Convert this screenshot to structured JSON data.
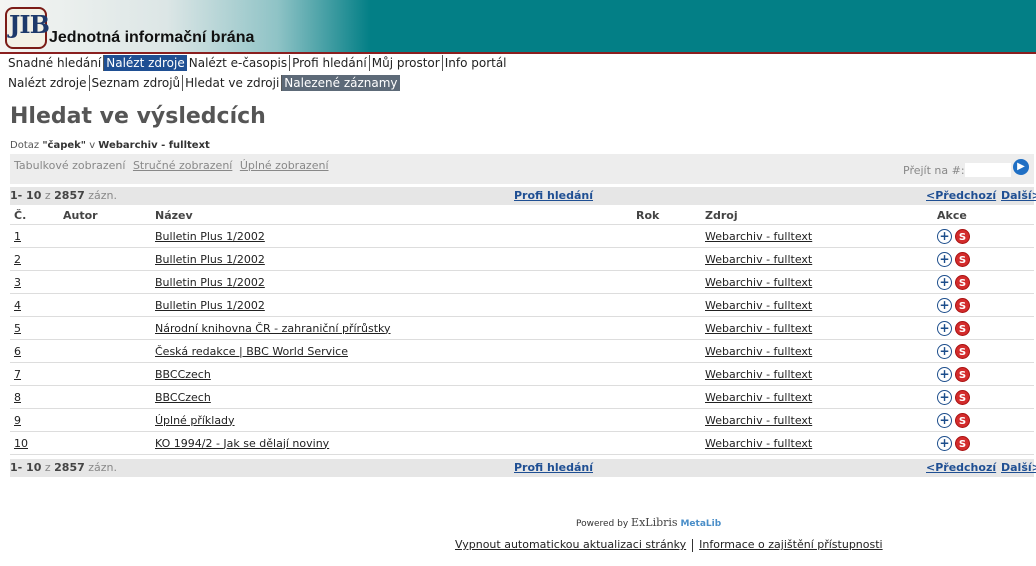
{
  "banner": {
    "logo": "JIB",
    "brand": "Jednotná informační brána"
  },
  "nav1": [
    "Snadné hledání",
    "Nalézt zdroje",
    "Nalézt e-časopis",
    "Profi hledání",
    "Můj prostor",
    "Info portál"
  ],
  "nav2": [
    "Nalézt zdroje",
    "Seznam zdrojů",
    "Hledat ve zdroji",
    "Nalezené záznamy"
  ],
  "page_title": "Hledat ve výsledcích",
  "query": {
    "prefix": "Dotaz",
    "term": "\"čapek\"",
    "mid": "v",
    "source": "Webarchiv - fulltext"
  },
  "views": {
    "table": "Tabulkové zobrazení",
    "brief": "Stručné zobrazení",
    "full": "Úplné zobrazení",
    "goto_label": "Přejít na #:",
    "goto_value": ""
  },
  "pager": {
    "range": "1- 10",
    "of": "z",
    "total": "2857",
    "unit": "zázn.",
    "profi": "Profi hledání",
    "prev": "<Předchozí",
    "next": "Další>"
  },
  "columns": {
    "num": "Č.",
    "author": "Autor",
    "title": "Název",
    "year": "Rok",
    "source": "Zdroj",
    "actions": "Akce"
  },
  "rows": [
    {
      "num": "1",
      "author": "",
      "title": "Bulletin Plus 1/2002",
      "year": "",
      "source": "Webarchiv - fulltext"
    },
    {
      "num": "2",
      "author": "",
      "title": "Bulletin Plus 1/2002",
      "year": "",
      "source": "Webarchiv - fulltext"
    },
    {
      "num": "3",
      "author": "",
      "title": "Bulletin Plus 1/2002",
      "year": "",
      "source": "Webarchiv - fulltext"
    },
    {
      "num": "4",
      "author": "",
      "title": "Bulletin Plus 1/2002",
      "year": "",
      "source": "Webarchiv - fulltext"
    },
    {
      "num": "5",
      "author": "",
      "title": "Národní knihovna ČR - zahraniční přírůstky",
      "year": "",
      "source": "Webarchiv - fulltext"
    },
    {
      "num": "6",
      "author": "",
      "title": "Česká redakce | BBC World Service",
      "year": "",
      "source": "Webarchiv - fulltext"
    },
    {
      "num": "7",
      "author": "",
      "title": "BBCCzech",
      "year": "",
      "source": "Webarchiv - fulltext"
    },
    {
      "num": "8",
      "author": "",
      "title": "BBCCzech",
      "year": "",
      "source": "Webarchiv - fulltext"
    },
    {
      "num": "9",
      "author": "",
      "title": "Úplné příklady",
      "year": "",
      "source": "Webarchiv - fulltext"
    },
    {
      "num": "10",
      "author": "",
      "title": "KO 1994/2 - Jak se dělají noviny",
      "year": "",
      "source": "Webarchiv - fulltext"
    }
  ],
  "powered": {
    "text": "Powered by",
    "exlibris": "ExLibris",
    "metalib": "MetaLib"
  },
  "footer": {
    "link1": "Vypnout automatickou aktualizaci stránky",
    "link2": "Informace o zajištění přístupnosti"
  },
  "colors": {
    "banner": "#037f86",
    "active_nav": "#1f4f93",
    "active_subnav": "#5d6a78",
    "link_blue": "#1f4f93",
    "sfx_red": "#d32c2c"
  }
}
